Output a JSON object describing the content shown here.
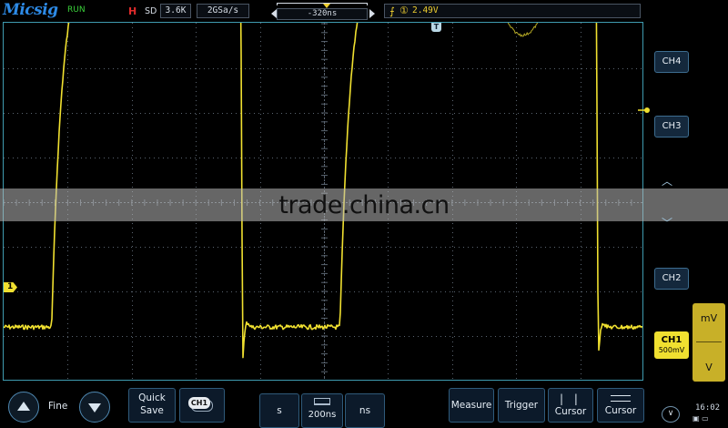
{
  "topbar": {
    "brand": "Micsig",
    "run_status": "RUN",
    "h_indicator": "H",
    "sd_label": "SD",
    "memory_depth": "3.6K",
    "sample_rate": "2GSa/s",
    "horizontal_position": "-320ns",
    "trigger_source_icon": "circled-1-icon",
    "trigger_edge_icon": "rising-edge-icon",
    "trigger_level": "2.49V"
  },
  "screen": {
    "watermark": "trade.china.cn",
    "trigger_position_marker": "T",
    "ch1_marker": "1",
    "colors": {
      "trace": "#f0e030",
      "grid": "#5a6470",
      "border": "#3f9bb0"
    },
    "waveform": {
      "levels_div": {
        "low": -2.8,
        "high": 5.5
      },
      "rising_edges_div": [
        0.75,
        5.25
      ],
      "falling_edges_div": [
        3.7,
        9.25
      ]
    }
  },
  "right_panel": {
    "channels": [
      {
        "label": "CH4"
      },
      {
        "label": "CH3"
      },
      {
        "label": "CH2"
      }
    ],
    "active_channel": {
      "label": "CH1",
      "scale": "500mV"
    },
    "volt_up_label": "mV",
    "volt_down_label": "V",
    "position_up_icon": "chevron-up-icon",
    "position_down_icon": "chevron-down-icon"
  },
  "bottombar": {
    "fine_label": "Fine",
    "quick_save_line1": "Quick",
    "quick_save_line2": "Save",
    "ref_chip": "CH1",
    "timebase_s": "s",
    "timebase_value": "200ns",
    "timebase_ns": "ns",
    "measure": "Measure",
    "trigger": "Trigger",
    "cursor_v": "Cursor",
    "cursor_h": "Cursor",
    "clock": "16:02"
  }
}
